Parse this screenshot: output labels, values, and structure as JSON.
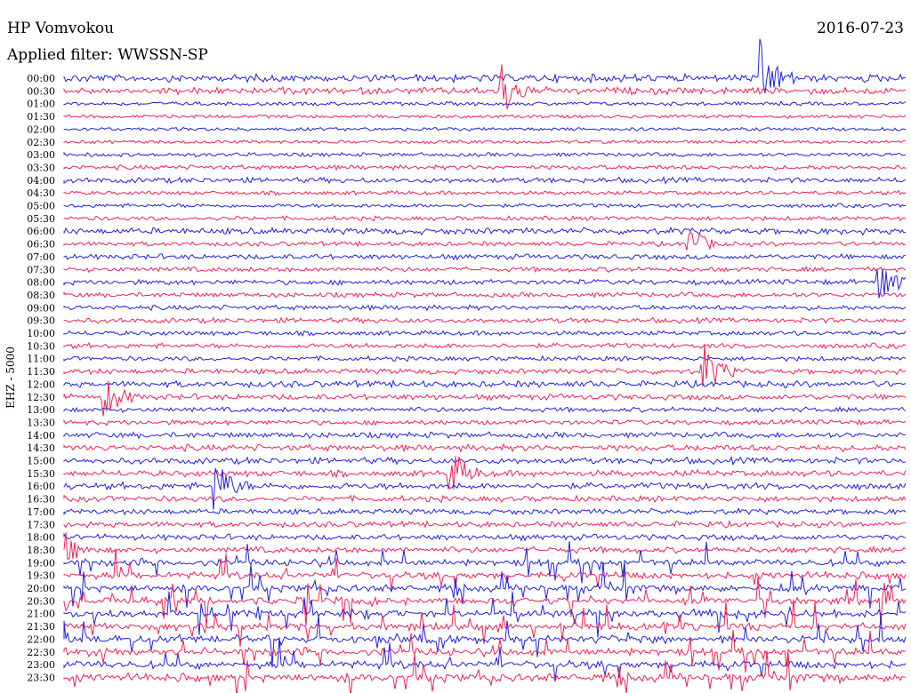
{
  "header": {
    "station": "HP Vomvokou",
    "date": "2016-07-23",
    "filter": "Applied filter: WWSSN-SP"
  },
  "colors": {
    "trace_a": "#2020dd",
    "trace_b": "#ee2255",
    "text": "#000000"
  },
  "chart_data": {
    "type": "line",
    "title": "HP Vomvokou",
    "subtitle": "Applied filter: WWSSN-SP",
    "ylabel": "EHZ - 5000",
    "xlabel": "",
    "grid": false,
    "legend": "none",
    "row_labels": [
      "00:00",
      "00:30",
      "01:00",
      "01:30",
      "02:00",
      "02:30",
      "03:00",
      "03:30",
      "04:00",
      "04:30",
      "05:00",
      "05:30",
      "06:00",
      "06:30",
      "07:00",
      "07:30",
      "08:00",
      "08:30",
      "09:00",
      "09:30",
      "10:00",
      "10:30",
      "11:00",
      "11:30",
      "12:00",
      "12:30",
      "13:00",
      "13:30",
      "14:00",
      "14:30",
      "15:00",
      "15:30",
      "16:00",
      "16:30",
      "17:00",
      "17:30",
      "18:00",
      "18:30",
      "19:00",
      "19:30",
      "20:00",
      "20:30",
      "21:00",
      "21:30",
      "22:00",
      "22:30",
      "23:00",
      "23:30"
    ],
    "row_colors": [
      "blue",
      "red"
    ],
    "row_activity": [
      0.9,
      0.8,
      0.25,
      0.2,
      0.2,
      0.2,
      0.3,
      0.4,
      0.55,
      0.3,
      0.3,
      0.35,
      0.7,
      0.4,
      0.5,
      0.45,
      0.5,
      0.45,
      0.45,
      0.5,
      0.4,
      0.5,
      0.4,
      0.55,
      0.7,
      0.6,
      0.45,
      0.45,
      0.6,
      0.7,
      0.7,
      0.7,
      0.75,
      0.6,
      0.55,
      0.6,
      0.6,
      0.65,
      0.75,
      0.8,
      0.8,
      0.85,
      0.85,
      0.85,
      0.9,
      0.9,
      0.95,
      1.0
    ],
    "events": [
      {
        "time": "00:30",
        "offset_frac": 0.52,
        "strength": 0.8
      },
      {
        "time": "00:00",
        "offset_frac": 0.83,
        "strength": 1.0
      },
      {
        "time": "06:30",
        "offset_frac": 0.74,
        "strength": 0.6
      },
      {
        "time": "08:00",
        "offset_frac": 0.97,
        "strength": 0.7
      },
      {
        "time": "11:30",
        "offset_frac": 0.76,
        "strength": 0.8
      },
      {
        "time": "12:30",
        "offset_frac": 0.05,
        "strength": 0.6
      },
      {
        "time": "15:30",
        "offset_frac": 0.46,
        "strength": 0.7
      },
      {
        "time": "16:00",
        "offset_frac": 0.18,
        "strength": 0.8
      },
      {
        "time": "18:30",
        "offset_frac": 0.0,
        "strength": 0.5
      }
    ]
  }
}
